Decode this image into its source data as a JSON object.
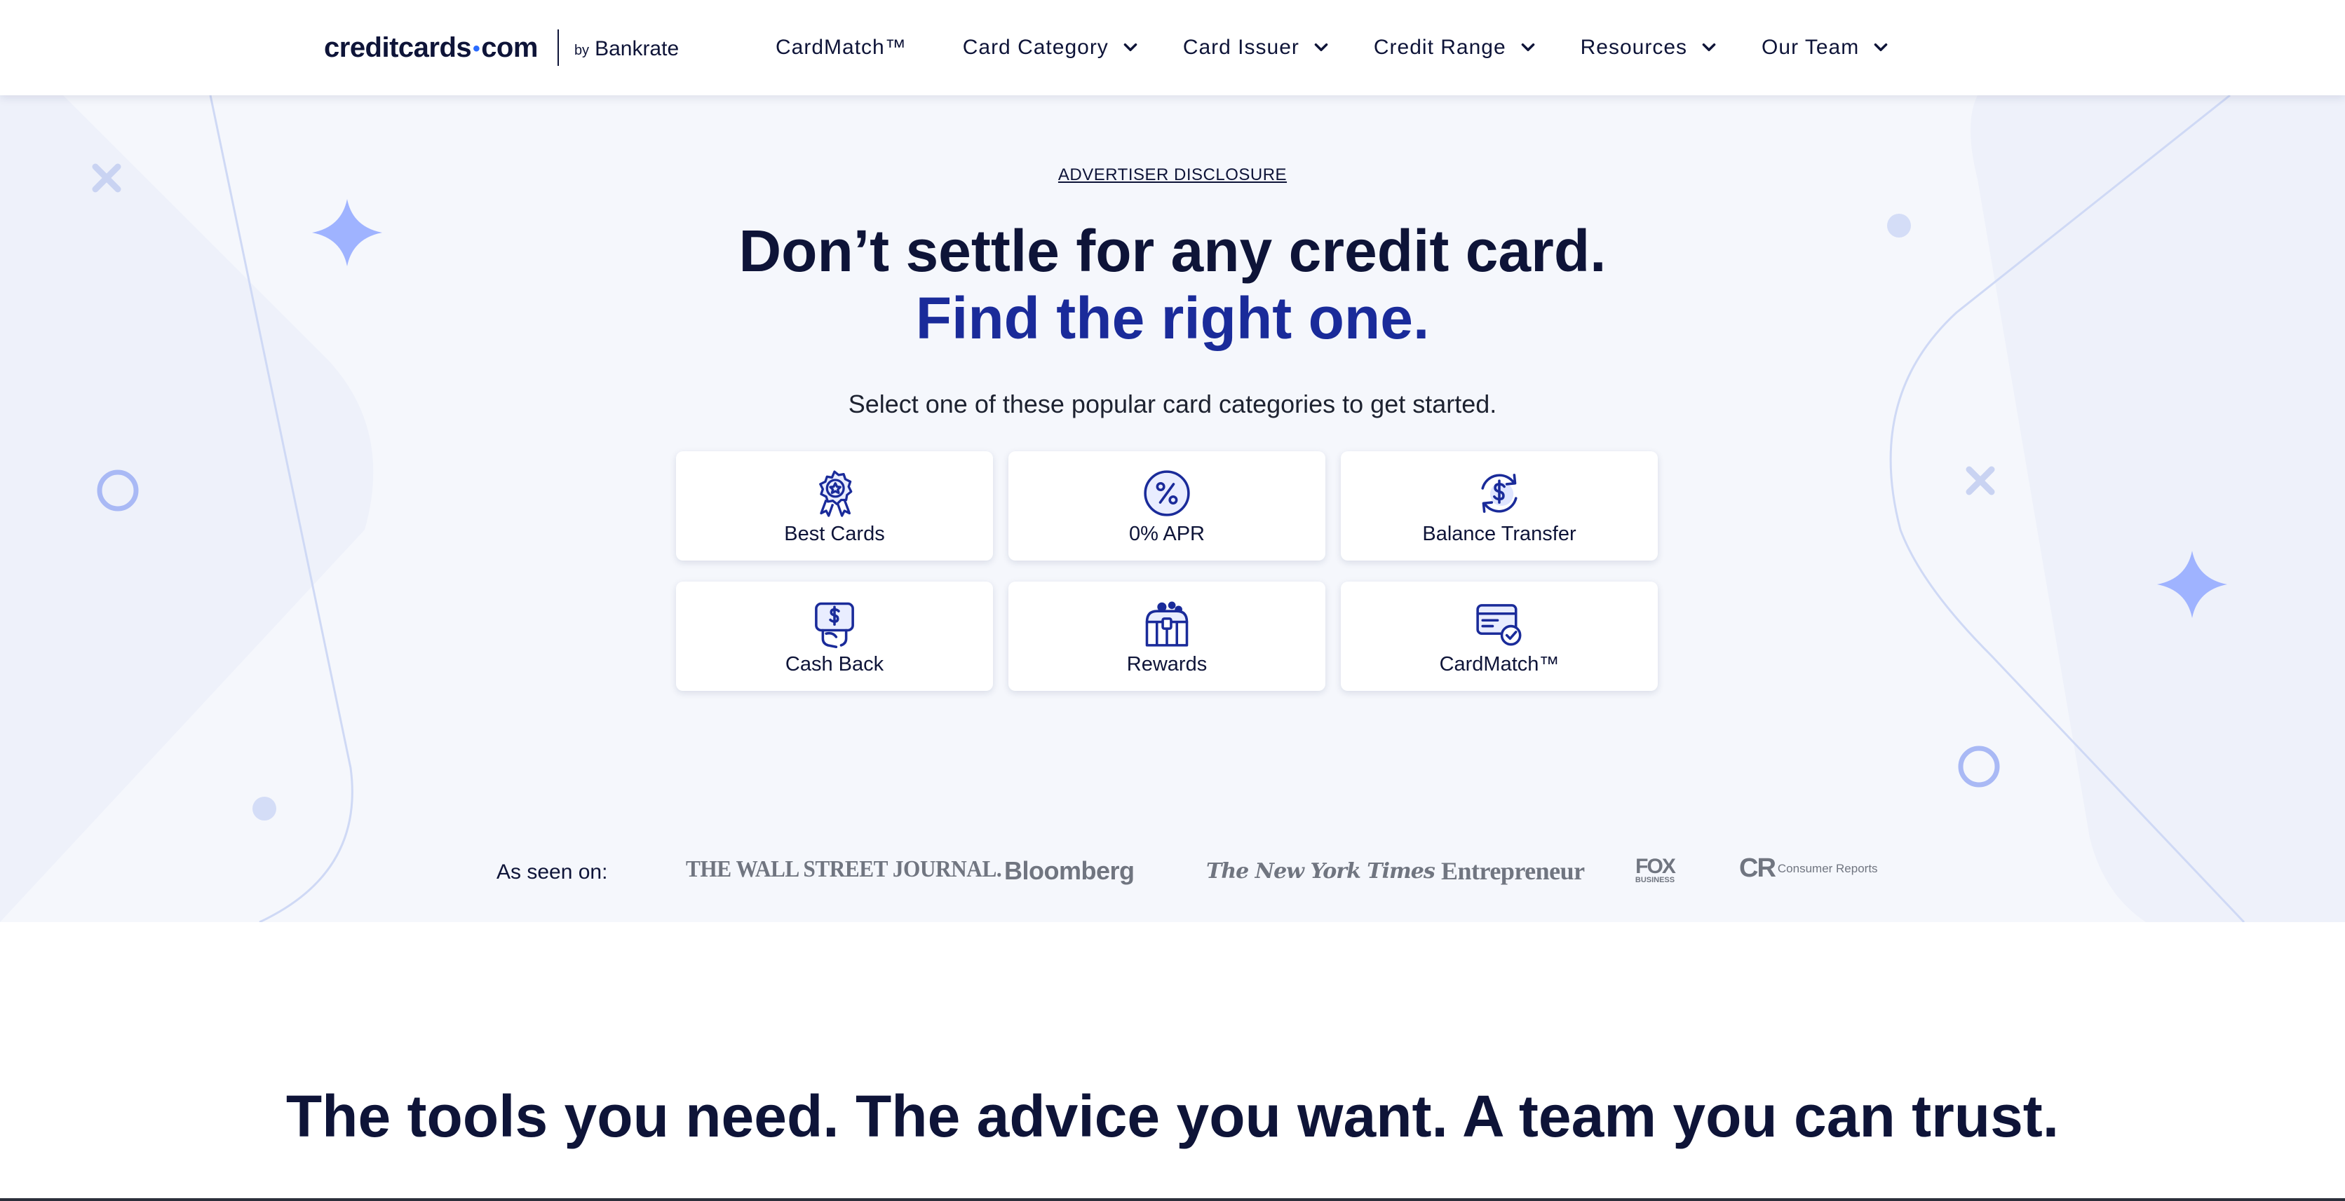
{
  "header": {
    "logo": {
      "brand": "creditcards",
      "dot": "•",
      "tld": "com",
      "by": "by",
      "partner": "Bankrate"
    },
    "nav": [
      {
        "label": "CardMatch™",
        "has_menu": false
      },
      {
        "label": "Card Category",
        "has_menu": true
      },
      {
        "label": "Card Issuer",
        "has_menu": true
      },
      {
        "label": "Credit Range",
        "has_menu": true
      },
      {
        "label": "Resources",
        "has_menu": true
      },
      {
        "label": "Our Team",
        "has_menu": true
      }
    ]
  },
  "hero": {
    "disclosure": "ADVERTISER DISCLOSURE",
    "headline_line1": "Don’t settle for any credit card.",
    "headline_line2": "Find the right one.",
    "subtitle": "Select one of these popular card categories to get started.",
    "categories": [
      {
        "label": "Best Cards",
        "icon": "award-ribbon-icon"
      },
      {
        "label": "0% APR",
        "icon": "percent-circle-icon"
      },
      {
        "label": "Balance Transfer",
        "icon": "dollar-refresh-icon"
      },
      {
        "label": "Cash Back",
        "icon": "cash-hand-icon"
      },
      {
        "label": "Rewards",
        "icon": "treasure-chest-icon"
      },
      {
        "label": "CardMatch™",
        "icon": "card-check-icon"
      }
    ]
  },
  "as_seen_on": {
    "label": "As seen on:",
    "publications": [
      "THE WALL STREET JOURNAL.",
      "Bloomberg",
      "The New York Times",
      "Entrepreneur",
      "FOX BUSINESS",
      "CR",
      "Consumer Reports"
    ]
  },
  "lower": {
    "title": "The tools you need. The advice you want. A team you can trust."
  },
  "colors": {
    "navy": "#0e1438",
    "accent_blue": "#1a2b9a",
    "hero_bg": "#f5f7fc",
    "decor_blue": "#9fb3ff",
    "logo_grey": "#707580"
  }
}
